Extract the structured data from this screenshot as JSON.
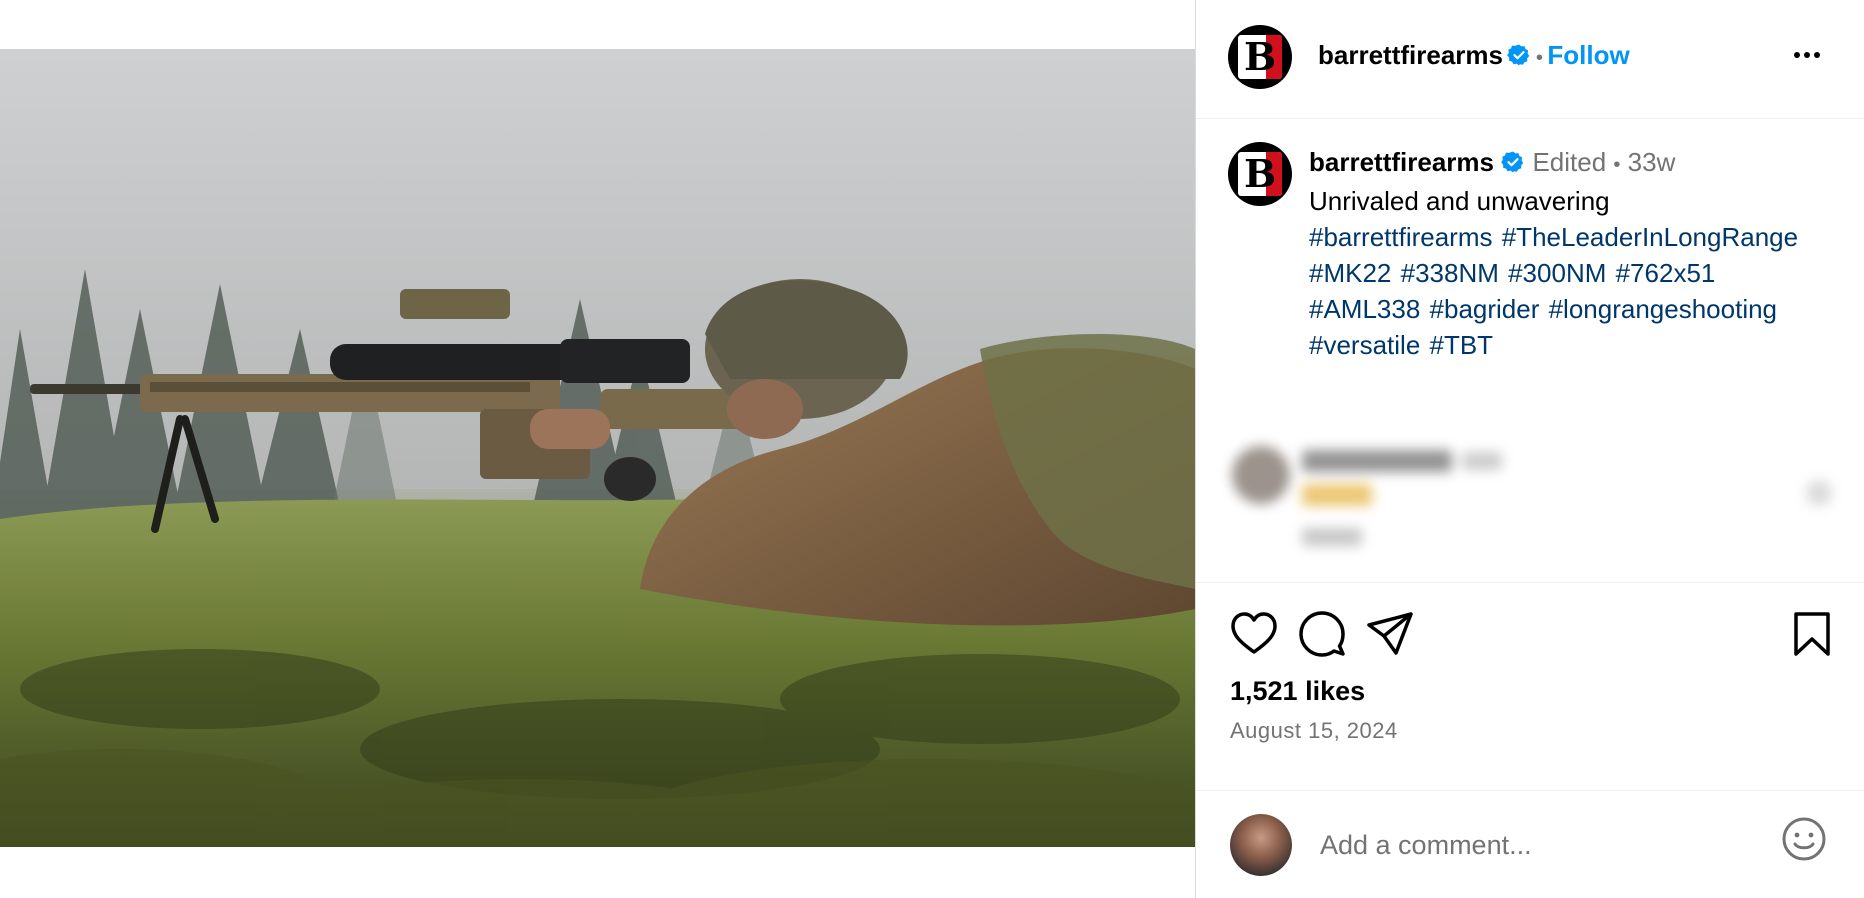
{
  "post": {
    "image_alt": "Soldier in camouflage aiming a sniper rifle from a prone position in wet grass",
    "author": {
      "username": "barrettfirearms",
      "verified": true,
      "avatar_letter": "B"
    },
    "header": {
      "follow_label": "Follow",
      "separator": "•"
    },
    "caption": {
      "username": "barrettfirearms",
      "edited_label": "Edited",
      "separator": "•",
      "age": "33w",
      "text": "Unrivaled and unwavering",
      "hashtags": "#barrettfirearms #TheLeaderInLongRange #MK22 #338NM #300NM #762x51 #AML338 #bagrider #longrangeshooting #versatile #TBT"
    },
    "stats": {
      "likes": "1,521 likes",
      "date": "August 15, 2024"
    },
    "comment_box": {
      "placeholder": "Add a comment..."
    }
  },
  "icons": [
    "verified-badge-icon",
    "more-options-icon",
    "heart-icon",
    "comment-icon",
    "share-icon",
    "bookmark-icon",
    "emoji-icon"
  ],
  "colors": {
    "link_blue": "#0095f6",
    "hashtag_blue": "#00376b",
    "verified_blue": "#0095f6",
    "muted_text": "#737373",
    "logo_red": "#d0101d"
  }
}
